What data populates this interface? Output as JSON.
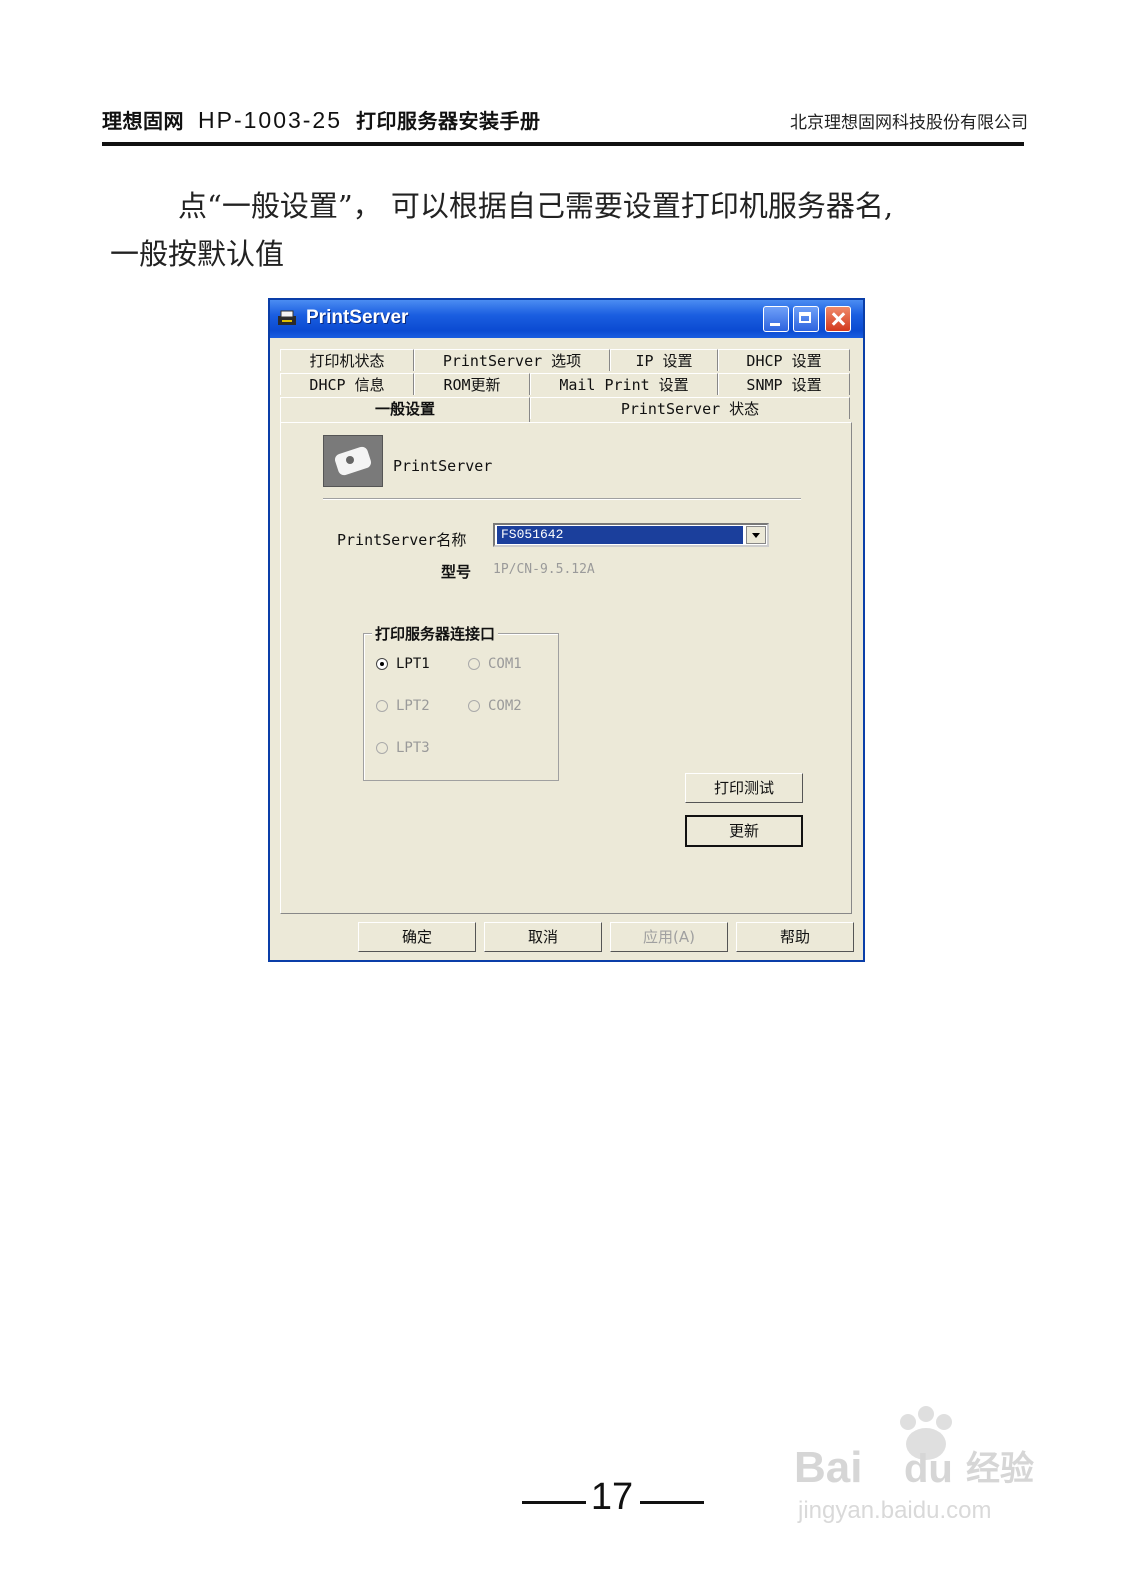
{
  "header": {
    "brand": "理想固网",
    "model": "HP-1003-25",
    "doc_title": "打印服务器安装手册",
    "company": "北京理想固网科技股份有限公司"
  },
  "body": {
    "line1": "点“一般设置”， 可以根据自己需要设置打印机服务器名,",
    "line2": "一般按默认值"
  },
  "dialog": {
    "title": "PrintServer",
    "tabs_row1": [
      "打印机状态",
      "PrintServer 选项",
      "IP 设置",
      "DHCP 设置"
    ],
    "tabs_row2": [
      "DHCP 信息",
      "ROM更新",
      "Mail Print 设置",
      "SNMP 设置"
    ],
    "tabs_row3": [
      "一般设置",
      "PrintServer 状态"
    ],
    "active_tab": "一般设置",
    "device_label": "PrintServer",
    "name_label": "PrintServer名称",
    "name_value": "FS051642",
    "model_label": "型号",
    "model_value": "1P/CN-9.5.12A",
    "port_group_title": "打印服务器连接口",
    "ports": [
      {
        "label": "LPT1",
        "selected": true,
        "enabled": true
      },
      {
        "label": "COM1",
        "selected": false,
        "enabled": false
      },
      {
        "label": "LPT2",
        "selected": false,
        "enabled": false
      },
      {
        "label": "COM2",
        "selected": false,
        "enabled": false
      },
      {
        "label": "LPT3",
        "selected": false,
        "enabled": false
      }
    ],
    "test_print_label": "打印测试",
    "update_label": "更新",
    "ok_label": "确定",
    "cancel_label": "取消",
    "apply_label": "应用(A)",
    "help_label": "帮助"
  },
  "page_number": "17",
  "colors": {
    "titlebar": "#1a5ee0",
    "dialog_bg": "#ece9d8",
    "selection": "#1b3f9c"
  }
}
